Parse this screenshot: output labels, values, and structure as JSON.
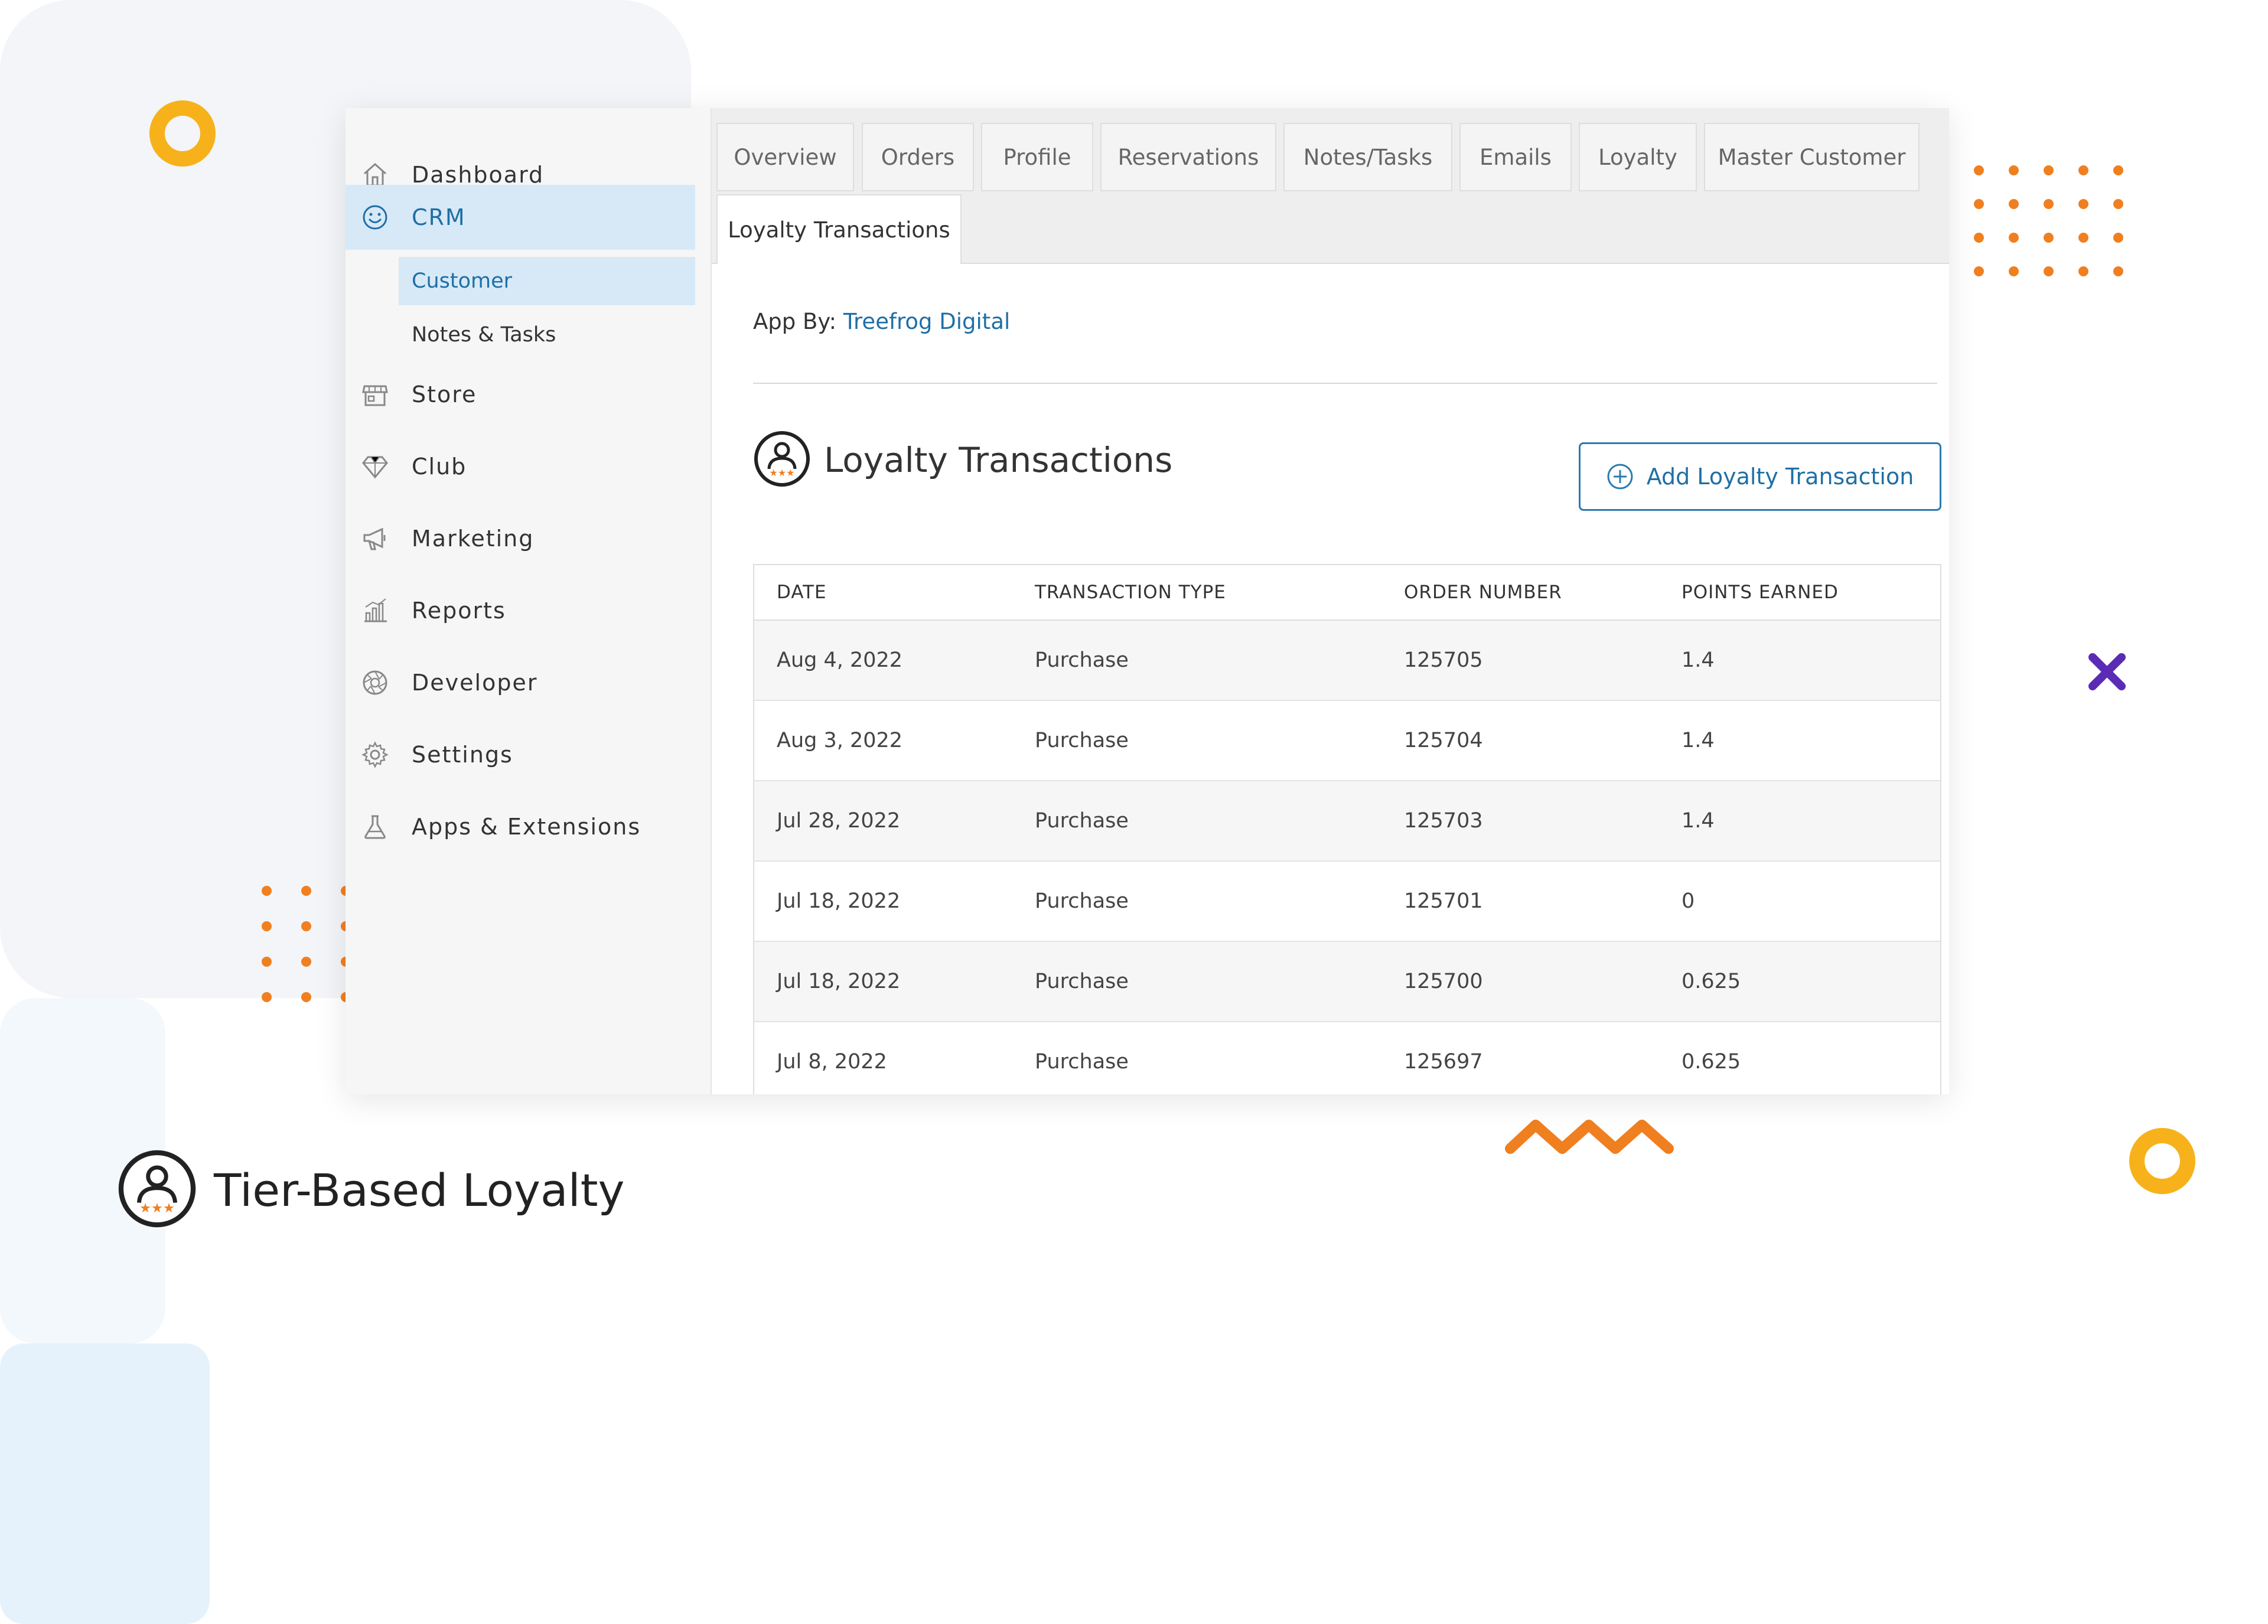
{
  "sidebar": {
    "items": [
      {
        "label": "Dashboard",
        "icon": "home-icon"
      },
      {
        "label": "CRM",
        "icon": "smiley-icon",
        "active": true
      },
      {
        "label": "Store",
        "icon": "storefront-icon"
      },
      {
        "label": "Club",
        "icon": "diamond-icon"
      },
      {
        "label": "Marketing",
        "icon": "megaphone-icon"
      },
      {
        "label": "Reports",
        "icon": "bar-chart-icon"
      },
      {
        "label": "Developer",
        "icon": "aperture-icon"
      },
      {
        "label": "Settings",
        "icon": "gear-icon"
      },
      {
        "label": "Apps & Extensions",
        "icon": "flask-icon"
      }
    ],
    "crm_sub": [
      {
        "label": "Customer",
        "active": true
      },
      {
        "label": "Notes & Tasks"
      }
    ]
  },
  "tabs": [
    "Overview",
    "Orders",
    "Profile",
    "Reservations",
    "Notes/Tasks",
    "Emails",
    "Loyalty",
    "Master Customer"
  ],
  "active_tab": "Loyalty Transactions",
  "app_by": {
    "prefix": "App By:",
    "vendor": "Treefrog Digital"
  },
  "section": {
    "title": "Loyalty Transactions",
    "add_button": "Add Loyalty Transaction"
  },
  "table": {
    "headers": [
      "DATE",
      "TRANSACTION TYPE",
      "ORDER NUMBER",
      "POINTS EARNED"
    ],
    "rows": [
      [
        "Aug 4, 2022",
        "Purchase",
        "125705",
        "1.4"
      ],
      [
        "Aug 3, 2022",
        "Purchase",
        "125704",
        "1.4"
      ],
      [
        "Jul 28, 2022",
        "Purchase",
        "125703",
        "1.4"
      ],
      [
        "Jul 18, 2022",
        "Purchase",
        "125701",
        "0"
      ],
      [
        "Jul 18, 2022",
        "Purchase",
        "125700",
        "0.625"
      ],
      [
        "Jul 8, 2022",
        "Purchase",
        "125697",
        "0.625"
      ]
    ]
  },
  "brand": {
    "title": "Tier-Based Loyalty"
  },
  "colors": {
    "accent": "#1f6fa5",
    "active_bg": "#d7e9f7",
    "ring_yellow": "#f7b21b",
    "dot_orange": "#f07f1f",
    "cross_purple": "#5b2bb5"
  }
}
